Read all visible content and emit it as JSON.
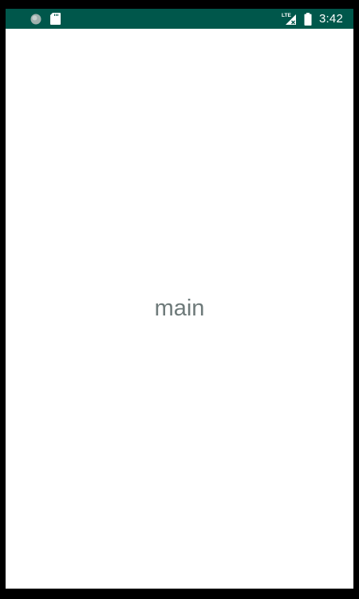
{
  "status_bar": {
    "background_color": "#00574b",
    "time": "3:42",
    "network_label": "LTE",
    "left_icons": [
      "circle-notification-icon",
      "sd-card-icon"
    ],
    "right_icons": [
      "lte-signal-icon",
      "battery-icon"
    ]
  },
  "main": {
    "label": "main",
    "text_color": "#6e7a7a"
  }
}
